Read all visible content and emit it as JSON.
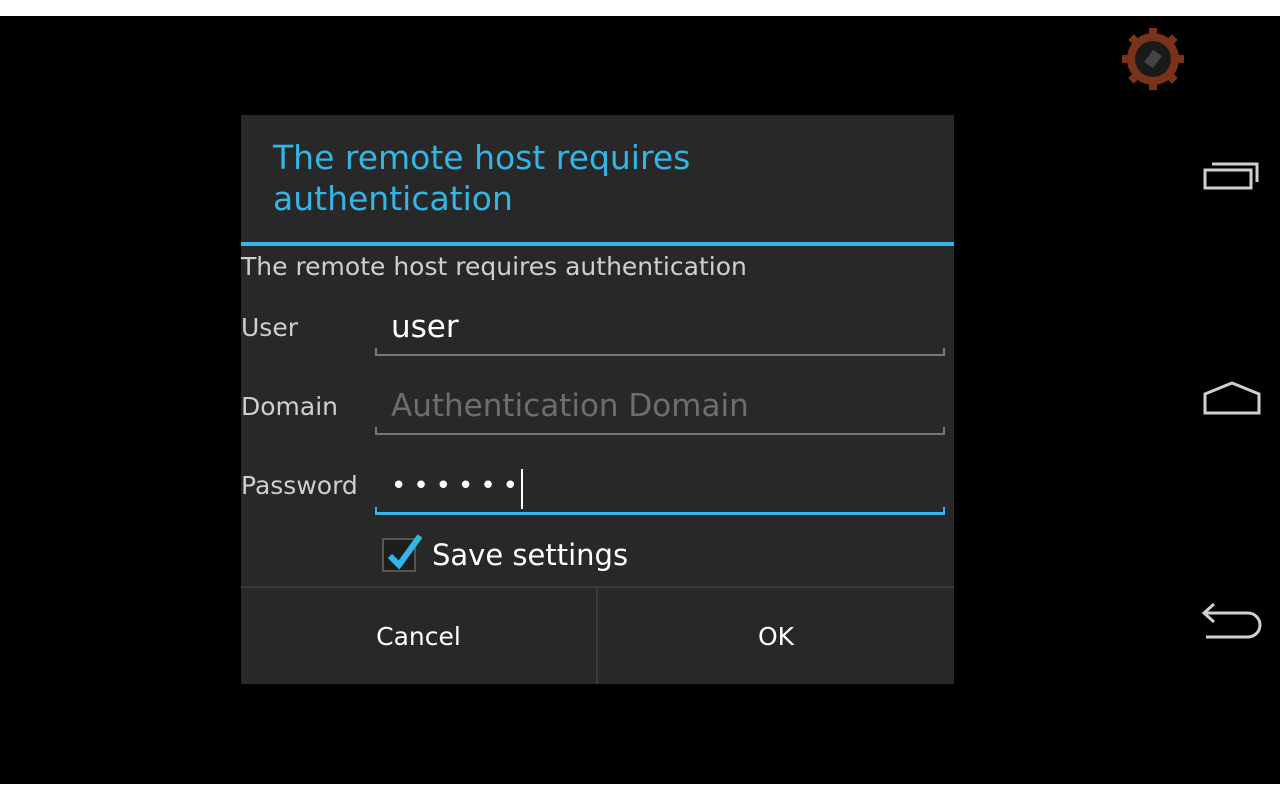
{
  "dialog": {
    "title": "The remote host requires authentication",
    "message": "The remote host requires authentication",
    "fields": {
      "user": {
        "label": "User",
        "value": "user",
        "placeholder": ""
      },
      "domain": {
        "label": "Domain",
        "value": "",
        "placeholder": "Authentication Domain"
      },
      "password": {
        "label": "Password",
        "value": "••••••"
      }
    },
    "save_settings": {
      "label": "Save settings",
      "checked": true
    },
    "buttons": {
      "cancel": "Cancel",
      "ok": "OK"
    }
  },
  "navbar": {
    "icons": [
      "recent-apps-icon",
      "home-icon",
      "back-icon"
    ]
  },
  "background": {
    "icon": "gear-icon"
  },
  "colors": {
    "accent": "#33b5e5",
    "dialog_bg": "#282828",
    "screen_bg": "#000000",
    "gear": "#8b3a1e"
  }
}
